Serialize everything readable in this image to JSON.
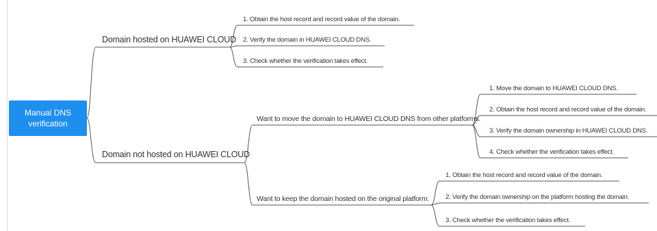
{
  "root": {
    "line1": "Manual DNS",
    "line2": "verification"
  },
  "branches": [
    {
      "label": "Domain hosted on HUAWEI CLOUD",
      "steps": [
        "1. Obtain the host record and record value of the domain.",
        "2. Verify the domain in HUAWEI CLOUD DNS.",
        "3. Check whether the verification takes effect."
      ]
    },
    {
      "label": "Domain not hosted on HUAWEI CLOUD",
      "scenarios": [
        {
          "label": "Want to move the domain to HUAWEI CLOUD DNS from other platforms.",
          "steps": [
            "1. Move the domain to HUAWEI CLOUD DNS.",
            "2. Obtain the host record and record value of the domain.",
            "3. Verify the domain ownership in HUAWEI CLOUD DNS.",
            "4. Check whether the verification takes effect."
          ]
        },
        {
          "label": "Want to keep the domain hosted on the original platform.",
          "steps": [
            "1. Obtain the host record and record value of the domain.",
            "2. Verify the domain ownership on the platform hosting the domain.",
            "3. Check whether the verification takes effect."
          ]
        }
      ]
    }
  ],
  "colors": {
    "root_fill": "#1f8ef1",
    "line": "#555555",
    "text": "#333333"
  }
}
